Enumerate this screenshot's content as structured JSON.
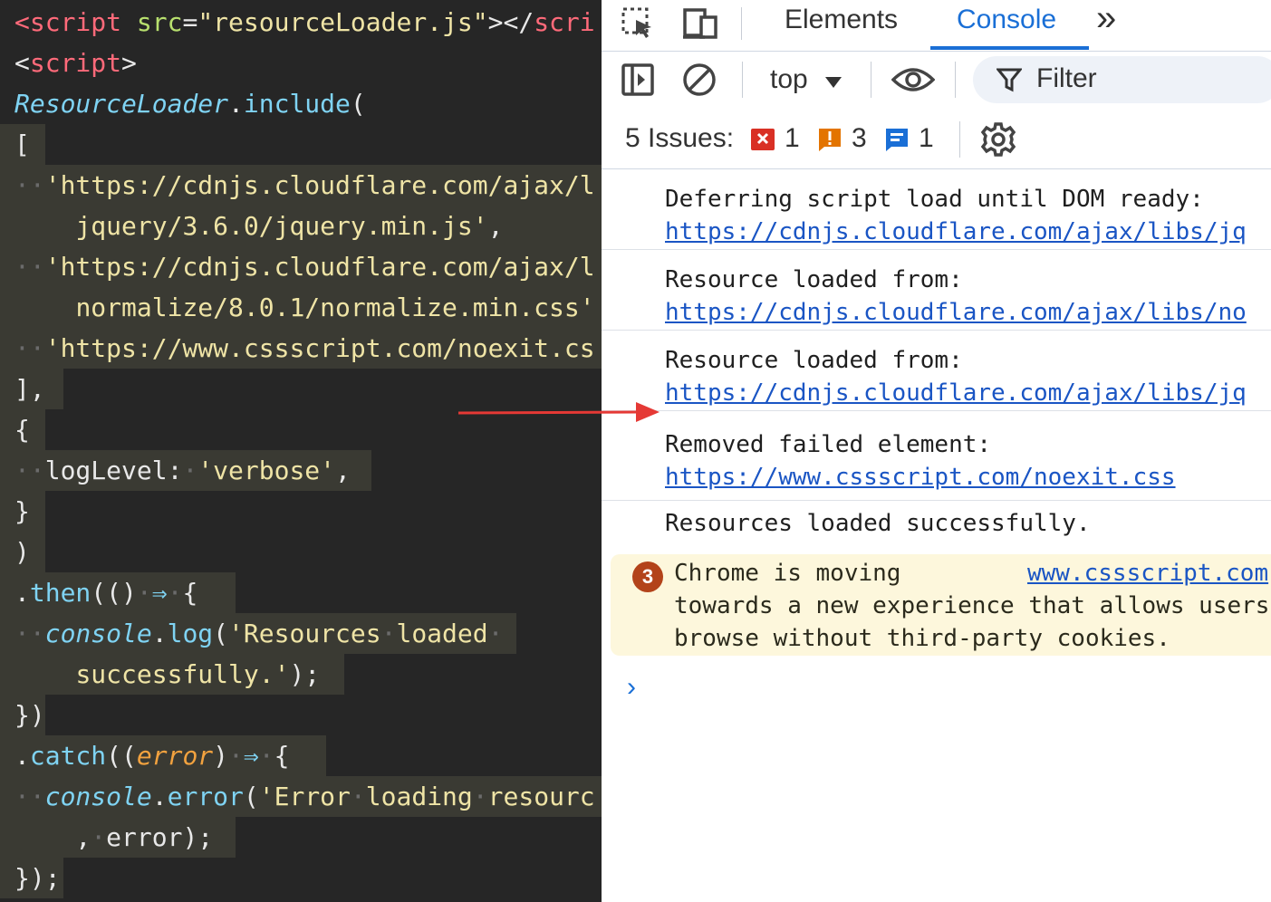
{
  "editor": {
    "lines": [
      {
        "segments": [
          {
            "c": "tag",
            "t": "<"
          },
          {
            "c": "tag",
            "t": "script"
          },
          {
            "c": "pl",
            "t": " "
          },
          {
            "c": "attr",
            "t": "src"
          },
          {
            "c": "pl",
            "t": "="
          },
          {
            "c": "str",
            "t": "\"resourceLoader.js\""
          },
          {
            "c": "pl",
            "t": "></"
          },
          {
            "c": "tag",
            "t": "scri"
          }
        ]
      },
      {
        "segments": [
          {
            "c": "pl",
            "t": "<"
          },
          {
            "c": "tag",
            "t": "script"
          },
          {
            "c": "pl",
            "t": ">"
          }
        ]
      },
      {
        "segments": [
          {
            "c": "cls",
            "t": "ResourceLoader"
          },
          {
            "c": "pl",
            "t": "."
          },
          {
            "c": "fn",
            "t": "include"
          },
          {
            "c": "pl",
            "t": "("
          }
        ]
      },
      {
        "segments": [
          {
            "c": "pl",
            "t": "["
          }
        ]
      },
      {
        "segments": [
          {
            "c": "ws",
            "t": "··"
          },
          {
            "c": "str",
            "t": "'https://cdnjs.cloudflare.com/ajax/l"
          }
        ]
      },
      {
        "segments": [
          {
            "c": "pl",
            "t": "    "
          },
          {
            "c": "str",
            "t": "jquery/3.6.0/jquery.min.js'"
          },
          {
            "c": "pl",
            "t": ","
          }
        ]
      },
      {
        "segments": [
          {
            "c": "ws",
            "t": "··"
          },
          {
            "c": "str",
            "t": "'https://cdnjs.cloudflare.com/ajax/l"
          }
        ]
      },
      {
        "segments": [
          {
            "c": "pl",
            "t": "    "
          },
          {
            "c": "str",
            "t": "normalize/8.0.1/normalize.min.css'"
          }
        ]
      },
      {
        "segments": [
          {
            "c": "ws",
            "t": "··"
          },
          {
            "c": "str",
            "t": "'https://www.cssscript.com/noexit.cs"
          }
        ]
      },
      {
        "segments": [
          {
            "c": "pl",
            "t": "],"
          }
        ]
      },
      {
        "segments": [
          {
            "c": "pl",
            "t": "{"
          }
        ]
      },
      {
        "segments": [
          {
            "c": "ws",
            "t": "··"
          },
          {
            "c": "pl",
            "t": "logLevel:"
          },
          {
            "c": "ws",
            "t": "·"
          },
          {
            "c": "str",
            "t": "'verbose'"
          },
          {
            "c": "pl",
            "t": ","
          }
        ]
      },
      {
        "segments": [
          {
            "c": "pl",
            "t": "}"
          }
        ]
      },
      {
        "segments": [
          {
            "c": "pl",
            "t": ")"
          }
        ]
      },
      {
        "segments": [
          {
            "c": "pl",
            "t": "."
          },
          {
            "c": "fn",
            "t": "then"
          },
          {
            "c": "pl",
            "t": "(()"
          },
          {
            "c": "ws",
            "t": "·"
          },
          {
            "c": "arrowop",
            "t": "⇒"
          },
          {
            "c": "ws",
            "t": "·"
          },
          {
            "c": "pl",
            "t": "{"
          }
        ]
      },
      {
        "segments": [
          {
            "c": "ws",
            "t": "··"
          },
          {
            "c": "ital",
            "t": "console"
          },
          {
            "c": "pl",
            "t": "."
          },
          {
            "c": "fn",
            "t": "log"
          },
          {
            "c": "pl",
            "t": "("
          },
          {
            "c": "str",
            "t": "'Resources"
          },
          {
            "c": "ws",
            "t": "·"
          },
          {
            "c": "str",
            "t": "loaded"
          },
          {
            "c": "ws",
            "t": "·"
          }
        ]
      },
      {
        "segments": [
          {
            "c": "pl",
            "t": "    "
          },
          {
            "c": "str",
            "t": "successfully.'"
          },
          {
            "c": "pl",
            "t": ");"
          }
        ]
      },
      {
        "segments": [
          {
            "c": "pl",
            "t": "})"
          }
        ]
      },
      {
        "segments": [
          {
            "c": "pl",
            "t": "."
          },
          {
            "c": "fn",
            "t": "catch"
          },
          {
            "c": "pl",
            "t": "(("
          },
          {
            "c": "err",
            "t": "error"
          },
          {
            "c": "pl",
            "t": ")"
          },
          {
            "c": "ws",
            "t": "·"
          },
          {
            "c": "arrowop",
            "t": "⇒"
          },
          {
            "c": "ws",
            "t": "·"
          },
          {
            "c": "pl",
            "t": "{"
          }
        ]
      },
      {
        "segments": [
          {
            "c": "ws",
            "t": "··"
          },
          {
            "c": "ital",
            "t": "console"
          },
          {
            "c": "pl",
            "t": "."
          },
          {
            "c": "fn",
            "t": "error"
          },
          {
            "c": "pl",
            "t": "("
          },
          {
            "c": "str",
            "t": "'Error"
          },
          {
            "c": "ws",
            "t": "·"
          },
          {
            "c": "str",
            "t": "loading"
          },
          {
            "c": "ws",
            "t": "·"
          },
          {
            "c": "str",
            "t": "resourc"
          }
        ]
      },
      {
        "segments": [
          {
            "c": "pl",
            "t": "    ,"
          },
          {
            "c": "ws",
            "t": "·"
          },
          {
            "c": "pl",
            "t": "error);"
          }
        ]
      },
      {
        "segments": [
          {
            "c": "pl",
            "t": "});"
          }
        ]
      }
    ]
  },
  "devtools": {
    "tabs": {
      "elements": "Elements",
      "console": "Console",
      "more": "»"
    },
    "toolbar": {
      "context": "top",
      "filter_placeholder": "Filter"
    },
    "issues": {
      "label": "5 Issues:",
      "errors": "1",
      "warnings": "3",
      "info": "1"
    },
    "messages": [
      {
        "text": "Deferring script load until DOM ready:",
        "url": "https://cdnjs.cloudflare.com/ajax/libs/jq"
      },
      {
        "text": "Resource loaded from:",
        "url": "https://cdnjs.cloudflare.com/ajax/libs/no"
      },
      {
        "text": "Resource loaded from:",
        "url": "https://cdnjs.cloudflare.com/ajax/libs/jq"
      },
      {
        "text": "Removed failed element:",
        "url": "https://www.cssscript.com/noexit.css"
      },
      {
        "text": "Resources loaded successfully.",
        "url": ""
      }
    ],
    "warning": {
      "count": "3",
      "line1": "Chrome is moving",
      "link": "www.cssscript.com",
      "line2": "towards a new experience that allows users",
      "line3": "browse without third-party cookies."
    },
    "prompt": "›"
  },
  "colors": {
    "accent": "#1a6fd6",
    "error": "#d93025",
    "warning": "#e37400",
    "info": "#1a6fd6",
    "arrow": "#e53935"
  }
}
